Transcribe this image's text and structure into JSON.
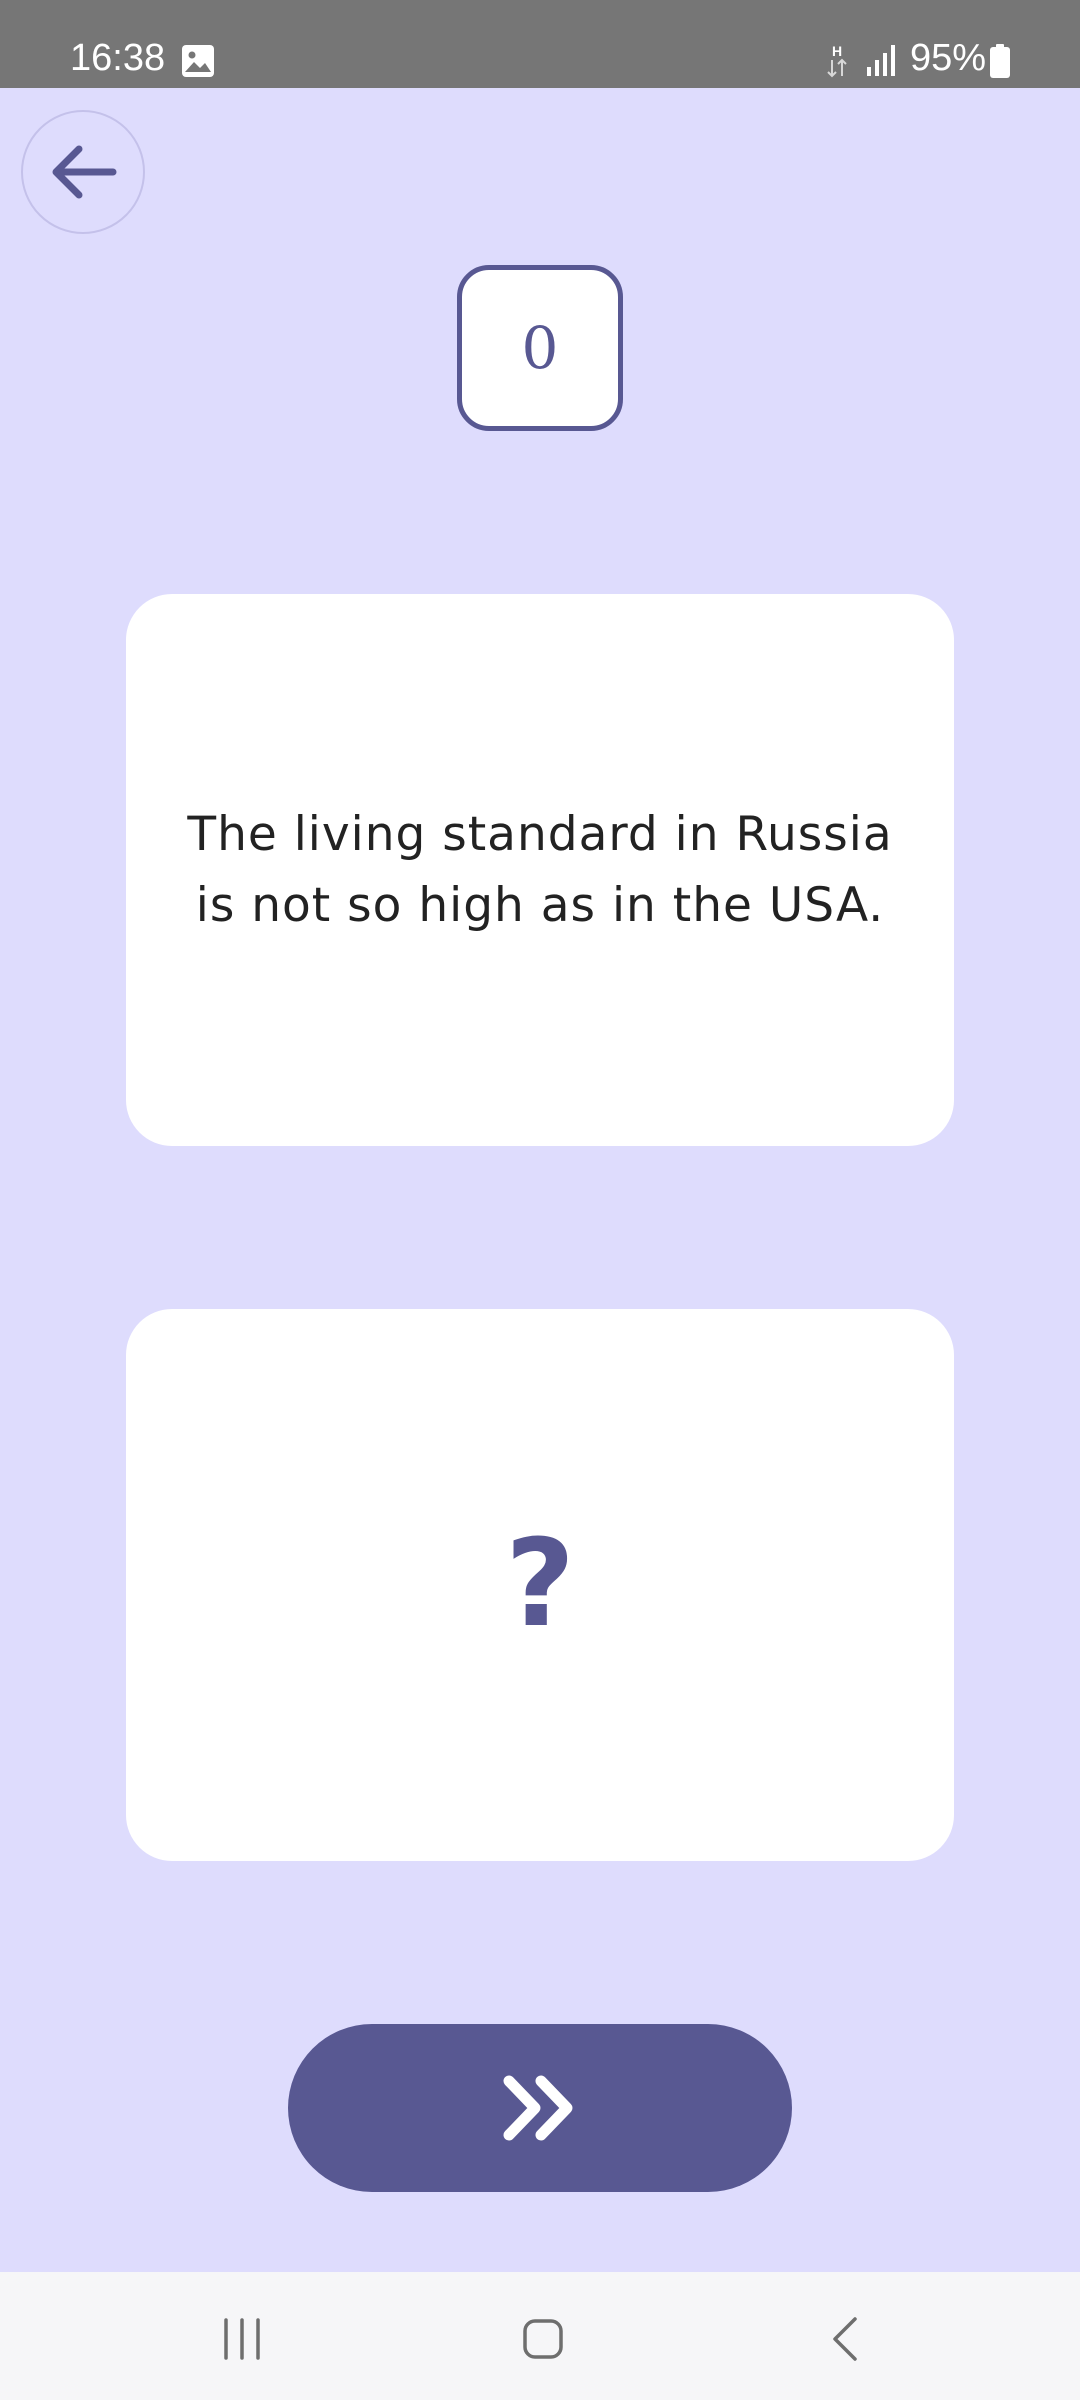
{
  "status_bar": {
    "time": "16:38",
    "battery": "95%",
    "network_label": "H",
    "icons": [
      "gallery-icon",
      "network-h-icon",
      "signal-icon",
      "battery-icon"
    ]
  },
  "header": {
    "back_icon": "arrow-left-icon",
    "counter": "0"
  },
  "cards": {
    "question": "The living standard in Russia is not so high as in the USA.",
    "answer": "?"
  },
  "next_button": {
    "icon": "double-chevron-right-icon"
  },
  "nav_bar": {
    "icons": [
      "recents-icon",
      "home-icon",
      "back-icon"
    ]
  },
  "colors": {
    "background": "#dedcfd",
    "accent": "#585892",
    "card": "#ffffff",
    "status_bar": "#767676",
    "nav_bar": "#f6f6f8"
  }
}
